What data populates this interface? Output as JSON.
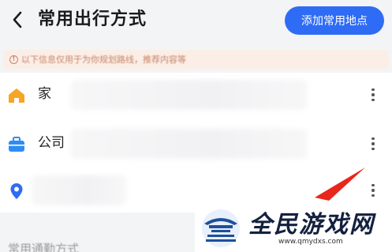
{
  "header": {
    "title": "常用出行方式",
    "add_button_label": "添加常用地点"
  },
  "notice": {
    "text": "以下信息仅用于为你规划路线，推荐内容等"
  },
  "places": [
    {
      "label": "家",
      "icon": "home-icon",
      "icon_color": "#f5a623"
    },
    {
      "label": "公司",
      "icon": "briefcase-icon",
      "icon_color": "#2f8cf6"
    },
    {
      "label": "",
      "icon": "location-pin-icon",
      "icon_color": "#2f6cf6"
    }
  ],
  "section": {
    "title": "常用通勤方式"
  },
  "watermark": {
    "title": "全民游戏网",
    "url": "www.qmydxs.com"
  },
  "colors": {
    "accent": "#2f6cf6",
    "notice_bg": "#fbeee6",
    "notice_text": "#c8846a",
    "annotation_arrow": "#e8261c"
  }
}
